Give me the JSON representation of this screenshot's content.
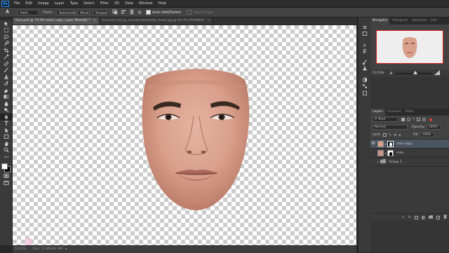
{
  "app": {
    "logo": "Ps"
  },
  "menu": [
    "File",
    "Edit",
    "Image",
    "Layer",
    "Type",
    "Select",
    "Filter",
    "3D",
    "View",
    "Window",
    "Help"
  ],
  "options": {
    "mode": "Path",
    "make_label": "Make:",
    "selection_btn": "Selection...",
    "mask_btn": "Mask",
    "shape_btn": "Shape",
    "auto_add_delete": "Auto Add/Delete",
    "align_edges": "Align Edges"
  },
  "tabs": [
    {
      "label": "face.psd @ 73.5% (man copy, Layer Mask/8) *",
      "active": true
    },
    {
      "label": "licensed_24_by_wavebreakmedia_stock.jpg @ 66.7% (RGB/8#)",
      "active": false
    }
  ],
  "status": {
    "zoom": "73.53%",
    "doc": "Doc: 11.8M/41.9M"
  },
  "navigator": {
    "tabs": [
      "Navigator",
      "Histogram",
      "Swatches",
      "Info"
    ],
    "zoom": "73.53%"
  },
  "layers_panel": {
    "tabs": [
      "Layers",
      "Channels",
      "Paths"
    ],
    "filter_kind": "Kind",
    "blend_mode": "Normal",
    "opacity_label": "Opacity:",
    "opacity": "100%",
    "lock_label": "Lock:",
    "fill_label": "Fill:",
    "fill": "100%",
    "layers": [
      {
        "name": "man copy",
        "type": "pixel-with-mask",
        "active": true,
        "visible": true
      },
      {
        "name": "man",
        "type": "pixel-with-mask",
        "active": false,
        "visible": false
      },
      {
        "name": "Group 1",
        "type": "group",
        "active": false,
        "visible": false
      }
    ],
    "bottom_icons": [
      "link-icon",
      "fx-icon",
      "mask-icon",
      "adjustment-icon",
      "folder-icon",
      "new-layer-icon",
      "trash-icon"
    ]
  },
  "tools": [
    "move",
    "marquee",
    "lasso",
    "quick-select",
    "crop",
    "eyedropper",
    "healing",
    "brush",
    "clone-stamp",
    "history-brush",
    "eraser",
    "gradient",
    "blur",
    "dodge",
    "pen",
    "type",
    "path-select",
    "rectangle",
    "hand",
    "zoom",
    "more"
  ],
  "colors": {
    "foreground": "#ffffff",
    "background": "#000000",
    "accent": "#31a8ff"
  }
}
